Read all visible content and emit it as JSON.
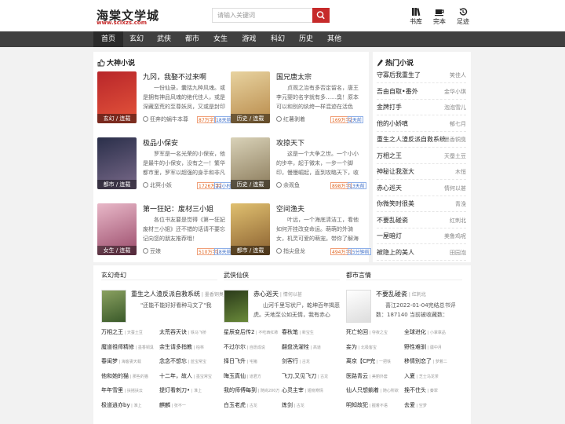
{
  "site": {
    "name": "海棠文学城",
    "url": "www.sclxzs.com"
  },
  "search": {
    "placeholder": "请输入关键词"
  },
  "header_actions": [
    {
      "label": "书库",
      "icon": "bookshelf-icon"
    },
    {
      "label": "完本",
      "icon": "coffee-cup-icon"
    },
    {
      "label": "足迹",
      "icon": "history-icon"
    }
  ],
  "nav": [
    "首页",
    "玄幻",
    "武侠",
    "都市",
    "女生",
    "游戏",
    "科幻",
    "历史",
    "其他"
  ],
  "featured": {
    "title": "大神小说",
    "books": [
      {
        "title": "九冈，我娶不过来啊",
        "desc": "一份仙录，囊括九种风魂。或是拥有神品风魂的绝代佳人，或是深藏蛮荒的至尊妖凤，又或是封印",
        "author": "狂奔的蜗牛本尊",
        "tag": "玄幻 / 连载",
        "words": "87万字",
        "status": "18天前",
        "colors": [
          "#b8262a",
          "#e5553b"
        ]
      },
      {
        "title": "国兄唐太宗",
        "desc": "贞观之治有多否定留名，唐王李元婴的名字就有多……臭！原本可以和别的纨绔一样混迹在活色",
        "author": "红薯剥着",
        "tag": "历史 / 连载",
        "words": "169万字",
        "status": "2天前",
        "colors": [
          "#e8d3a0",
          "#b88a4a"
        ]
      },
      {
        "title": "极品小保安",
        "desc": "罗军是一名光荣的小保安，他是最牛的小保安，没有之一！繁华都市里，罗军以超强的身手和非凡",
        "author": "北冥小妖",
        "tag": "都市 / 连载",
        "words": "1726万字",
        "status": "22小时前",
        "colors": [
          "#2a2f4a",
          "#7a6a8a"
        ]
      },
      {
        "title": "攻掠天下",
        "desc": "这是一个大争之世。一个小小的步卒，起于微末，一步一个脚印，慢慢崛起，直到攻略天下，收",
        "author": "余观鱼",
        "tag": "历史 / 连载",
        "words": "898万字",
        "status": "13天前",
        "colors": [
          "#d9d2b8",
          "#8a7a5a"
        ]
      },
      {
        "title": "第一狂妃：废材三小姐",
        "desc": "各位书友要是觉得《第一狂妃废材三小姐》还不错的话请不要忘记向您的朋友推荐哦！",
        "author": "豆娘",
        "tag": "女生 / 连载",
        "words": "510万字",
        "status": "18天前",
        "colors": [
          "#e8b8c8",
          "#9a4a6a"
        ]
      },
      {
        "title": "空间渔夫",
        "desc": "叶远，一个海底清洁工，看他如何开挂改变命运。萌萌的外骑女，机灵可爱的萌宠。带你了解海",
        "author": "指尖盘龙",
        "tag": "都市 / 连载",
        "words": "494万字",
        "status": "15分钟前",
        "colors": [
          "#e0c070",
          "#8a6030"
        ]
      }
    ]
  },
  "hot": {
    "title": "热门小说",
    "items": [
      {
        "name": "守寡后我重生了",
        "author": "笑佳人"
      },
      {
        "name": "吾由自取•番外",
        "author": "金华小琪"
      },
      {
        "name": "金牌打手",
        "author": "泡泡雪儿"
      },
      {
        "name": "他的小娇嗔",
        "author": "郁七月"
      },
      {
        "name": "重生之人渣反派自救系统",
        "author": "墨香铜臭"
      },
      {
        "name": "万相之王",
        "author": "天蚕土豆"
      },
      {
        "name": "神秘让我涨大",
        "author": "木恒"
      },
      {
        "name": "赤心巡天",
        "author": "情何以甚"
      },
      {
        "name": "你微笑时很美",
        "author": "青浼"
      },
      {
        "name": "不要乱碰瓷",
        "author": "红刺北"
      },
      {
        "name": "一屋暗灯",
        "author": "美鲁鸡呢"
      },
      {
        "name": "被隐上的美人",
        "author": "田园泡"
      }
    ]
  },
  "columns": [
    {
      "title": "玄幻奇幻",
      "feature": {
        "title": "重生之人渣反派自救系统",
        "author": "墨香铜臭",
        "desc": "\"还能不能好好看种马文了\"我",
        "colors": [
          "#8aa060",
          "#3a5a2a"
        ]
      },
      "items": [
        [
          "万相之王",
          "天蚕土豆"
        ],
        [
          "太荒吞天诀",
          "铁马飞桥"
        ],
        [
          "魔道祖师精修",
          "墨香铜臭"
        ],
        [
          "余生请多指教",
          "柏林"
        ],
        [
          "春闺梦",
          "海客妻天载"
        ],
        [
          "念念不想忘",
          "蓝宝常宝"
        ],
        [
          "他和她的猫",
          "那些的猫"
        ],
        [
          "十二年，故人",
          "墨宝常宝"
        ],
        [
          "年年雪里",
          "扶摇扶云"
        ],
        [
          "提灯看刺刀•",
          "淮上"
        ],
        [
          "极道逍亦by",
          "淮上"
        ],
        [
          "麒麟",
          "张不一"
        ]
      ]
    },
    {
      "title": "武侠仙侠",
      "feature": {
        "title": "赤心巡天",
        "author": "情何以甚",
        "desc": "山河千里写状尸，乾坤百年揭恶虎。天地至公如无情，我有赤心",
        "colors": [
          "#2a3a1a",
          "#6a8a3a"
        ]
      },
      "items": [
        [
          "星辰变后传2",
          "不吃西红柿"
        ],
        [
          "春秋笔",
          "新宝生"
        ],
        [
          "不过尔尔",
          "自愿成说"
        ],
        [
          "翻盘洗濯栓",
          "高道"
        ],
        [
          "择日飞升",
          "宅猪"
        ],
        [
          "剑客行",
          "古龙"
        ],
        [
          "晦玉真仙",
          "道君方"
        ],
        [
          "飞刀,又见飞刀",
          "古龙"
        ],
        [
          "我的师傅每到",
          "随尚200万"
        ],
        [
          "心灵主宰",
          "姬晓寒情"
        ],
        [
          "白玉老虎",
          "古龙"
        ],
        [
          "炼剑",
          "古龙"
        ]
      ]
    },
    {
      "title": "都市言情",
      "feature": {
        "title": "不要乱碰瓷",
        "author": "红刺北",
        "desc": "喜江2022-01-04完结总书评数：187140 当前被收藏数：",
        "colors": [
          "#ffffff",
          "#dddddd"
        ]
      },
      "items": [
        [
          "死亡轮回",
          "夺夜之宝"
        ],
        [
          "全球进化",
          "小掌章品"
        ],
        [
          "妄为",
          "北极客宝"
        ],
        [
          "野性难驯",
          "疆中月"
        ],
        [
          "离京【CP完",
          "一把铁"
        ],
        [
          "移情别恋了",
          "梦着二"
        ],
        [
          "医路青云",
          "美丽外套"
        ],
        [
          "入夏",
          "芝士乌龙茶"
        ],
        [
          "仙人只想躺着",
          "随心所欲"
        ],
        [
          "挽不住头",
          "秦翠"
        ],
        [
          "明知故犯",
          "握着不语"
        ],
        [
          "去爱",
          "空梦"
        ]
      ]
    }
  ],
  "colors": {
    "accent": "#c62a2a",
    "nav_bg": "#404040"
  }
}
